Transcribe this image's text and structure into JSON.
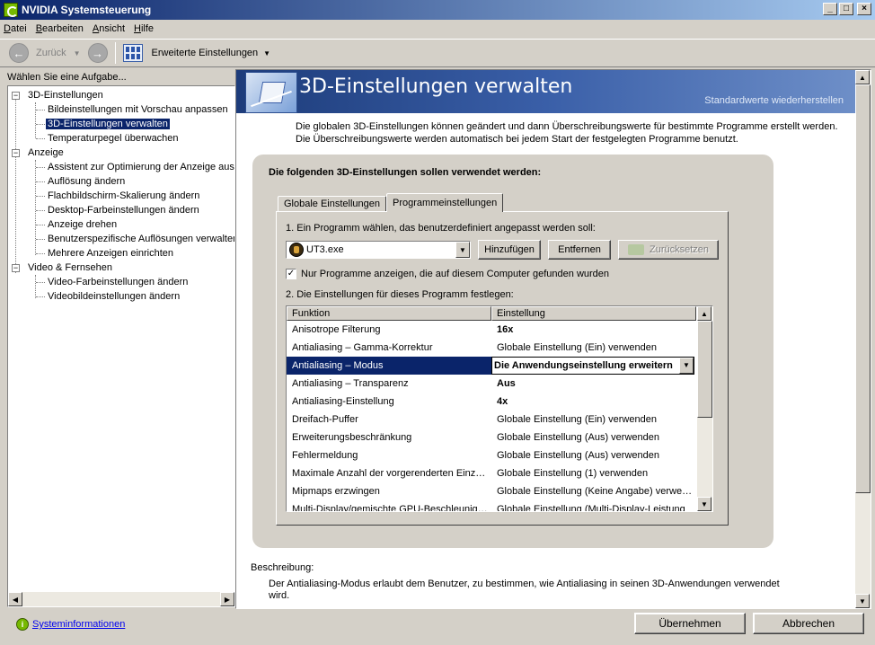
{
  "window": {
    "title": "NVIDIA Systemsteuerung"
  },
  "menu": [
    "Datei",
    "Bearbeiten",
    "Ansicht",
    "Hilfe"
  ],
  "toolbar": {
    "back": "Zurück",
    "advanced": "Erweiterte Einstellungen"
  },
  "sidebar": {
    "header": "Wählen Sie eine Aufgabe...",
    "groups": [
      {
        "label": "3D-Einstellungen",
        "items": [
          "Bildeinstellungen mit Vorschau anpassen",
          "3D-Einstellungen verwalten",
          "Temperaturpegel überwachen"
        ]
      },
      {
        "label": "Anzeige",
        "items": [
          "Assistent zur Optimierung der Anzeige ausf",
          "Auflösung ändern",
          "Flachbildschirm-Skalierung ändern",
          "Desktop-Farbeinstellungen ändern",
          "Anzeige drehen",
          "Benutzerspezifische Auflösungen verwalter",
          "Mehrere Anzeigen einrichten"
        ]
      },
      {
        "label": "Video & Fernsehen",
        "items": [
          "Video-Farbeinstellungen ändern",
          "Videobildeinstellungen ändern"
        ]
      }
    ],
    "selected": "3D-Einstellungen verwalten"
  },
  "main": {
    "title": "3D-Einstellungen verwalten",
    "restore_link": "Standardwerte wiederherstellen",
    "intro": "Die globalen 3D-Einstellungen können geändert und dann Überschreibungswerte für bestimmte Programme erstellt werden. Die Überschreibungswerte werden automatisch bei jedem Start der festgelegten Programme benutzt.",
    "section_heading": "Die folgenden 3D-Einstellungen sollen verwendet werden:",
    "tabs": [
      "Globale Einstellungen",
      "Programmeinstellungen"
    ],
    "active_tab": "Programmeinstellungen",
    "step1_label": "1. Ein Programm wählen, das benutzerdefiniert angepasst werden soll:",
    "program_value": "UT3.exe",
    "buttons": {
      "add": "Hinzufügen",
      "remove": "Entfernen",
      "reset": "Zurücksetzen"
    },
    "checkbox_label": "Nur Programme anzeigen, die auf diesem Computer gefunden wurden",
    "checkbox_checked": true,
    "step2_label": "2. Die Einstellungen für dieses Programm festlegen:",
    "columns": [
      "Funktion",
      "Einstellung"
    ],
    "rows": [
      {
        "f": "Anisotrope Filterung",
        "v": "16x",
        "bold": true
      },
      {
        "f": "Antialiasing – Gamma-Korrektur",
        "v": "Globale Einstellung (Ein) verwenden",
        "bold": false
      },
      {
        "f": "Antialiasing – Modus",
        "v": "Die Anwendungseinstellung erweitern",
        "bold": true,
        "selected": true
      },
      {
        "f": "Antialiasing – Transparenz",
        "v": "Aus",
        "bold": true
      },
      {
        "f": "Antialiasing-Einstellung",
        "v": "4x",
        "bold": true
      },
      {
        "f": "Dreifach-Puffer",
        "v": "Globale Einstellung (Ein) verwenden",
        "bold": false
      },
      {
        "f": "Erweiterungsbeschränkung",
        "v": "Globale Einstellung (Aus) verwenden",
        "bold": false
      },
      {
        "f": "Fehlermeldung",
        "v": "Globale Einstellung (Aus) verwenden",
        "bold": false
      },
      {
        "f": "Maximale Anzahl der vorgerenderten Einz…",
        "v": "Globale Einstellung (1) verwenden",
        "bold": false
      },
      {
        "f": "Mipmaps erzwingen",
        "v": "Globale Einstellung (Keine Angabe) verwe…",
        "bold": false
      },
      {
        "f": "Multi-Display/gemischte GPU-Beschleunigung",
        "v": "Globale Einstellung (Multi-Display-Leistung",
        "bold": false
      }
    ],
    "description_label": "Beschreibung:",
    "description_text": "Der Antialiasing-Modus erlaubt dem Benutzer, zu bestimmen, wie Antialiasing in seinen 3D-Anwendungen verwendet wird."
  },
  "footer": {
    "sysinfo": "Systeminformationen",
    "apply": "Übernehmen",
    "cancel": "Abbrechen"
  }
}
